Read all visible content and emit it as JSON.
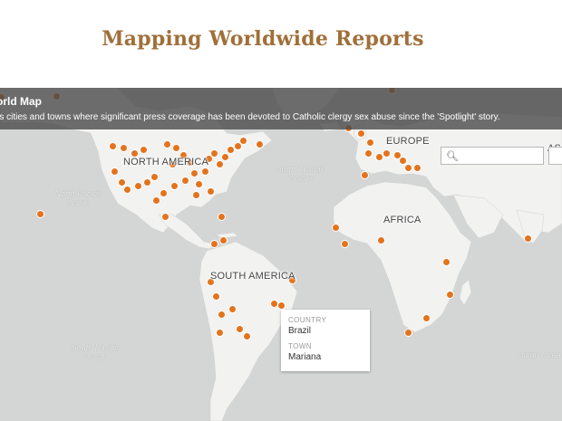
{
  "page": {
    "title": "Mapping Worldwide Reports"
  },
  "info": {
    "title": "orld Map",
    "description": "rs cities and towns where significant press coverage has been devoted to Catholic clergy sex abuse since the 'Spotlight' story."
  },
  "search": {
    "placeholder": "",
    "value": ""
  },
  "labels": {
    "continents": [
      "NORTH AMERICA",
      "SOUTH AMERICA",
      "EUROPE",
      "AFRICA",
      "ASI"
    ],
    "oceans": [
      "North Atlantic Ocean",
      "North Pacific Ocean",
      "South Pacific Ocean",
      "Indian Ocea"
    ]
  },
  "popup": {
    "country_label": "COUNTRY",
    "country": "Brazil",
    "town_label": "TOWN",
    "town": "Mariana"
  },
  "colors": {
    "marker": "#e3731d",
    "land": "#f2f2f1",
    "water": "#d4d6d6",
    "title": "#a0703a"
  }
}
